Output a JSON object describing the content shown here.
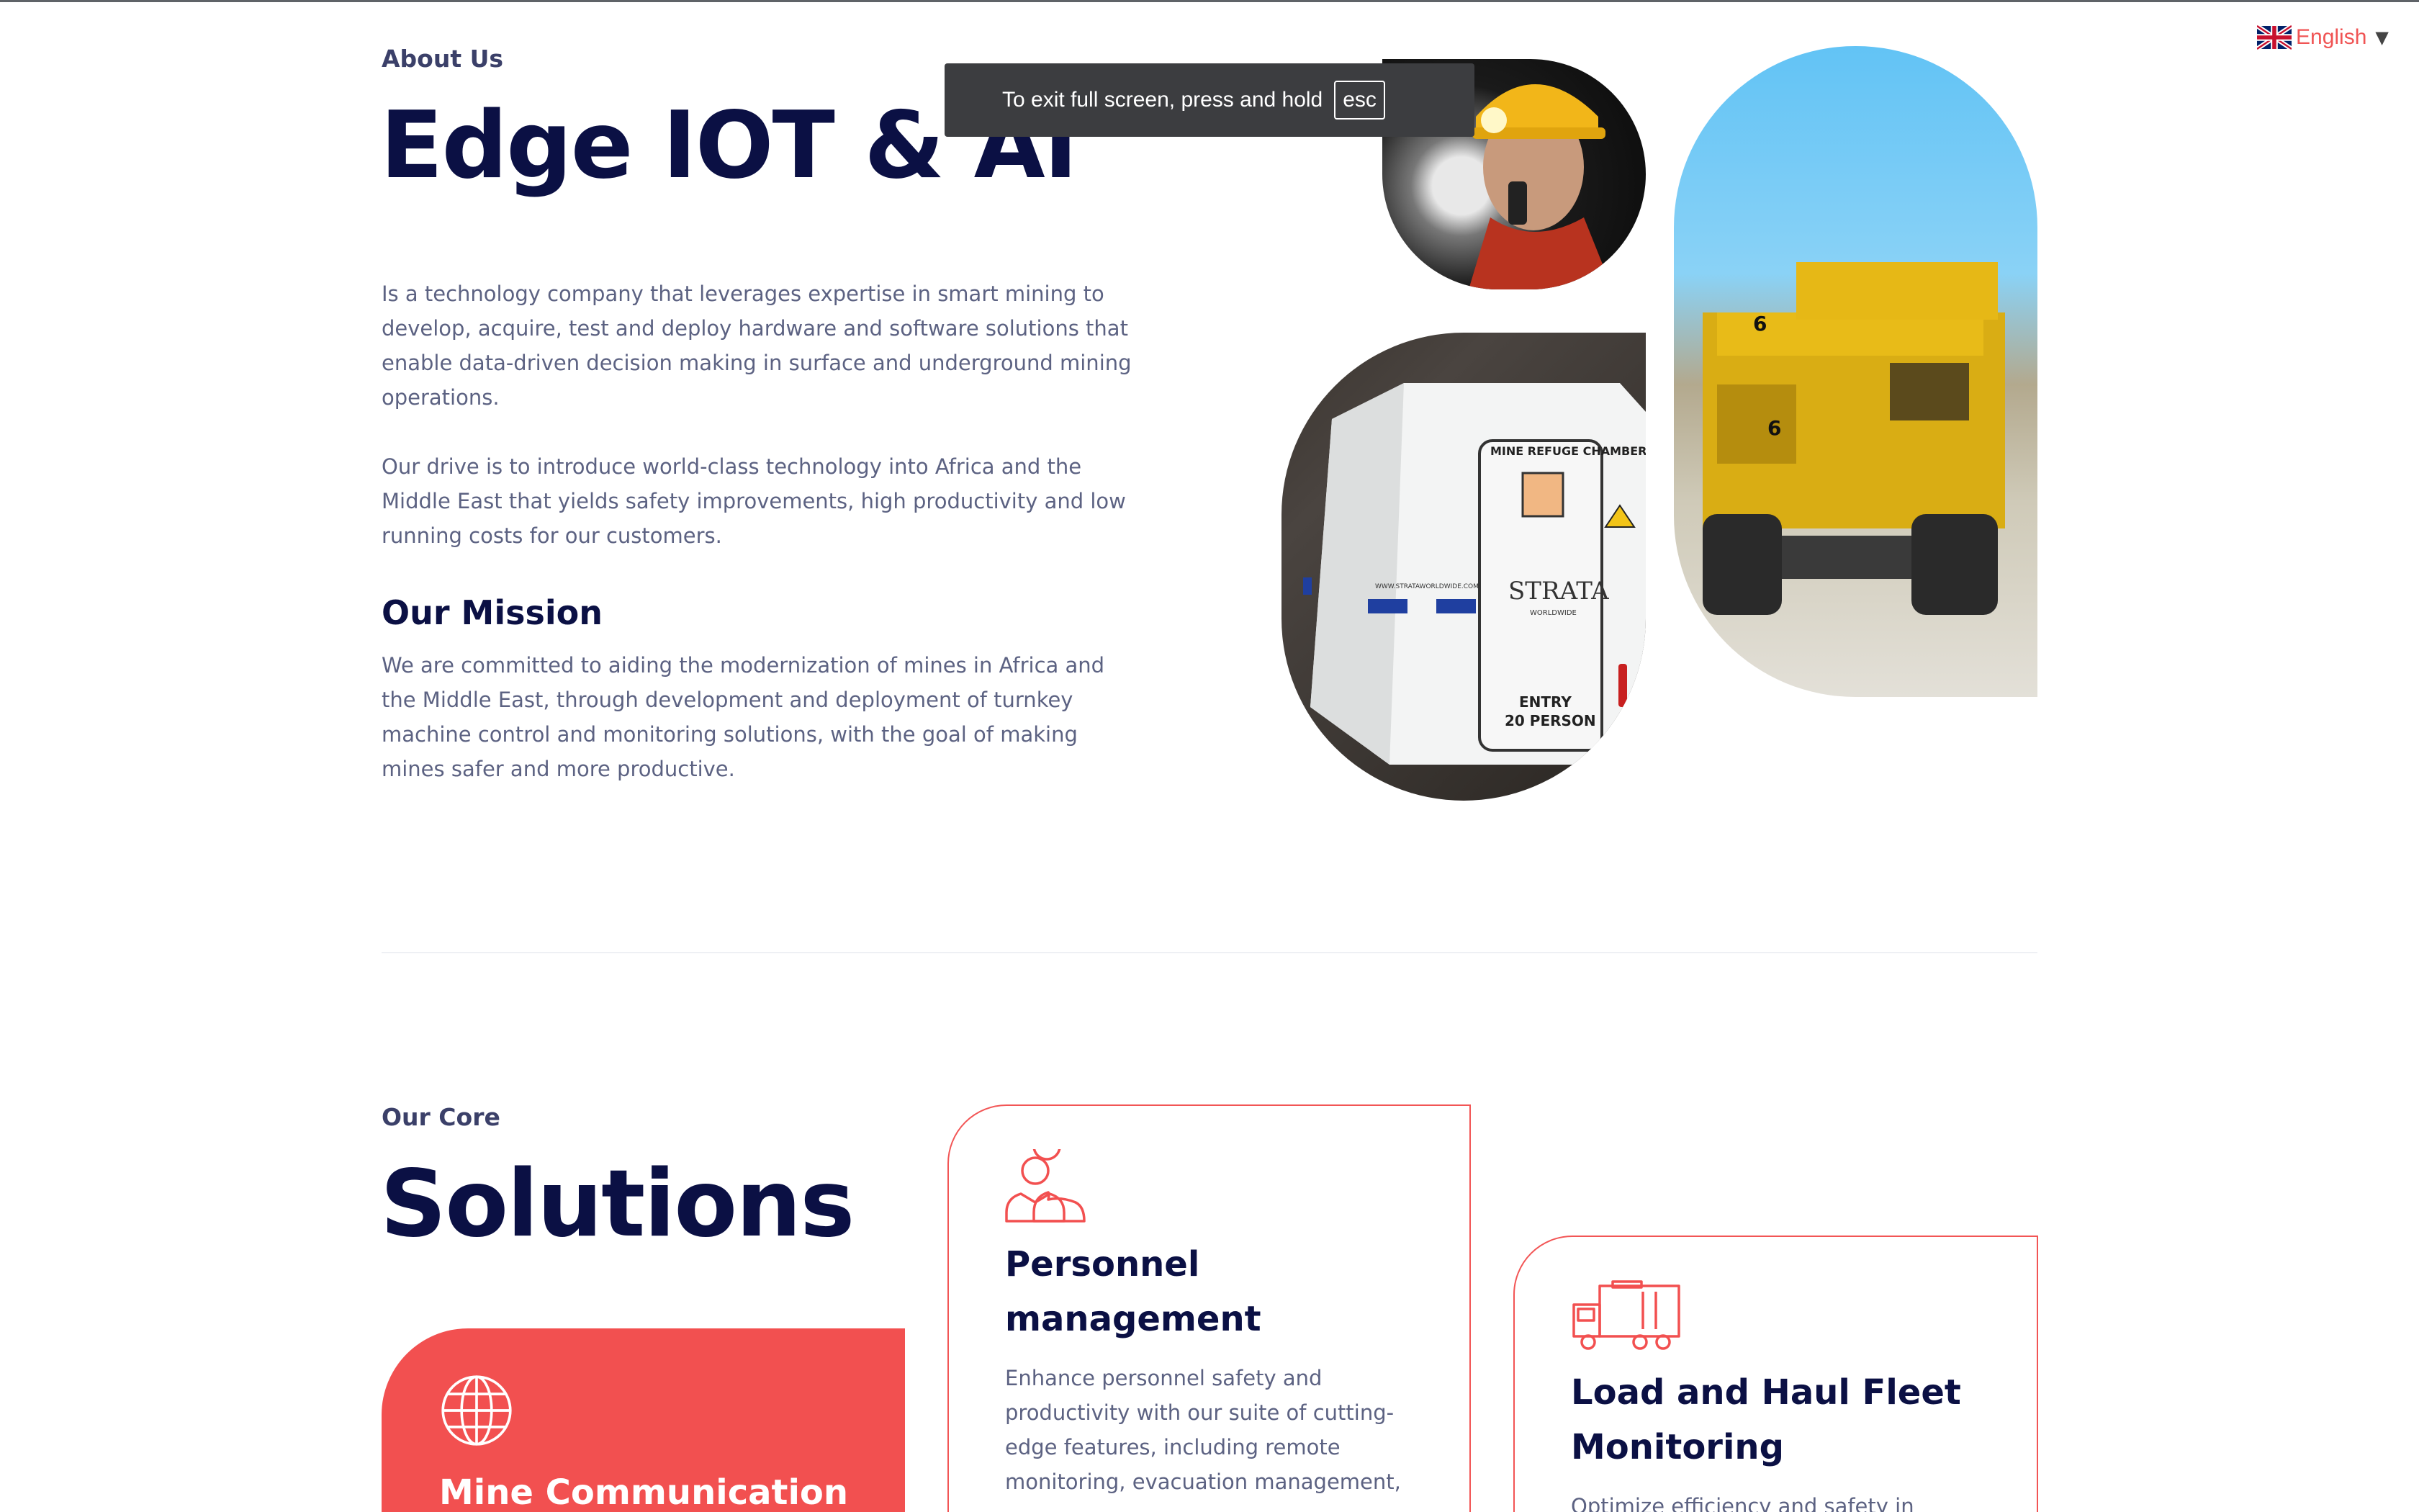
{
  "language": {
    "label": "English",
    "flag": "uk-flag-icon"
  },
  "fullscreen_toast": {
    "text": "To exit full screen, press and hold",
    "key": "esc"
  },
  "about": {
    "eyebrow": "About Us",
    "title": "Edge IOT & AI",
    "paragraph1": "Is a technology company that leverages expertise in smart mining to develop, acquire, test and deploy hardware and software solutions that enable data-driven decision making in surface and underground mining operations.",
    "paragraph2": "Our drive is to introduce world-class technology into Africa and the Middle East that yields safety improvements, high productivity and low running costs for our customers.",
    "mission_heading": "Our Mission",
    "mission_text": "We are committed to aiding the modernization of mines in Africa and the Middle East, through development and deployment of turnkey machine control and monitoring solutions, with the goal of making mines safer and more productive."
  },
  "images": {
    "chamber": {
      "label": "MINE REFUGE CHAMBER",
      "brand": "STRATA",
      "brand_sub": "WORLDWIDE",
      "entry": "ENTRY",
      "capacity": "20 PERSON",
      "url": "WWW.STRATAWORLDWIDE.COM"
    },
    "truck": {
      "number": "6"
    }
  },
  "solutions": {
    "eyebrow": "Our Core",
    "title": "Solutions",
    "cards": [
      {
        "title": "Mine Communication",
        "icon": "globe-icon"
      },
      {
        "title": "Personnel management",
        "icon": "users-icon",
        "body": "Enhance personnel safety and productivity with our suite of cutting-edge features, including remote monitoring, evacuation management,"
      },
      {
        "title": "Load and Haul Fleet Monitoring",
        "icon": "fleet-truck-icon",
        "body": "Optimize efficiency and safety in"
      }
    ]
  },
  "colors": {
    "accent": "#f25050",
    "navy": "#0b1044",
    "body_text": "#5c6282"
  }
}
